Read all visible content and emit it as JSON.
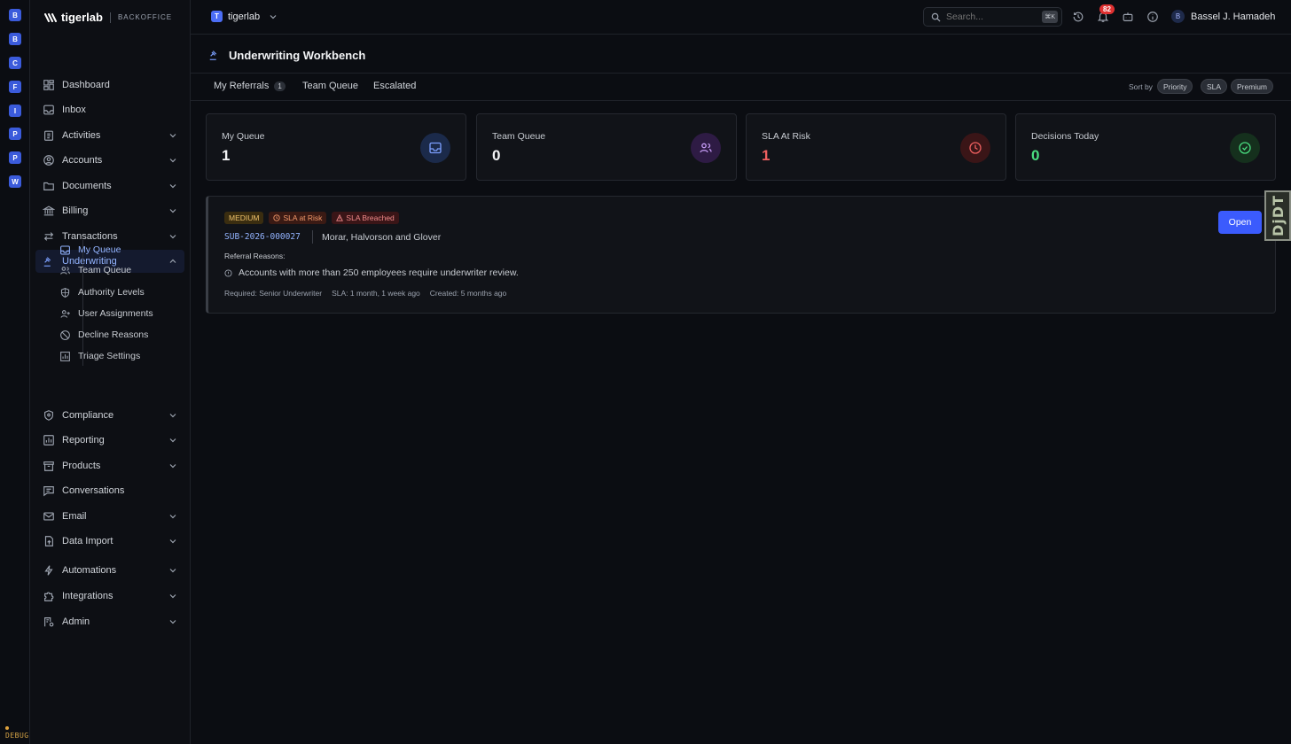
{
  "rail": {
    "items": [
      "B",
      "B",
      "C",
      "F",
      "I",
      "P",
      "P",
      "W"
    ],
    "debug": "DEBUG"
  },
  "brand": {
    "name": "tigerlab",
    "sub": "BACKOFFICE"
  },
  "sidebar": {
    "items": [
      {
        "label": "Dashboard"
      },
      {
        "label": "Inbox"
      },
      {
        "label": "Activities"
      },
      {
        "label": "Accounts"
      },
      {
        "label": "Documents"
      },
      {
        "label": "Billing"
      },
      {
        "label": "Transactions"
      },
      {
        "label": "Underwriting"
      },
      {
        "label": "Compliance"
      },
      {
        "label": "Reporting"
      },
      {
        "label": "Products"
      },
      {
        "label": "Conversations"
      },
      {
        "label": "Email"
      },
      {
        "label": "Data Import"
      },
      {
        "label": "Automations"
      },
      {
        "label": "Integrations"
      },
      {
        "label": "Admin"
      }
    ],
    "sub_items": [
      {
        "label": "My Queue"
      },
      {
        "label": "Team Queue"
      },
      {
        "label": "Authority Levels"
      },
      {
        "label": "User Assignments"
      },
      {
        "label": "Decline Reasons"
      },
      {
        "label": "Triage Settings"
      }
    ]
  },
  "topbar": {
    "tenant_initial": "T",
    "tenant_name": "tigerlab",
    "search_placeholder": "Search...",
    "search_shortcut": "⌘K",
    "notifications": "82",
    "user_initial": "B",
    "user_name": "Bassel J. Hamadeh"
  },
  "page": {
    "title": "Underwriting Workbench"
  },
  "tabs": [
    {
      "label": "My Referrals",
      "count": "1"
    },
    {
      "label": "Team Queue"
    },
    {
      "label": "Escalated"
    }
  ],
  "sort": {
    "label": "Sort by",
    "options": [
      "Priority",
      "SLA",
      "Premium"
    ]
  },
  "stats": [
    {
      "label": "My Queue",
      "value": "1",
      "color": "#f3f4f6",
      "icon": "inbox-icon",
      "icon_bg": "#1b2a4a",
      "icon_color": "#7ca0ff"
    },
    {
      "label": "Team Queue",
      "value": "0",
      "color": "#f3f4f6",
      "icon": "users-icon",
      "icon_bg": "#2e1b44",
      "icon_color": "#c59bf5"
    },
    {
      "label": "SLA At Risk",
      "value": "1",
      "color": "#f06060",
      "icon": "clock-icon",
      "icon_bg": "#3a1517",
      "icon_color": "#f06060"
    },
    {
      "label": "Decisions Today",
      "value": "0",
      "color": "#4ade80",
      "icon": "check-circle-icon",
      "icon_bg": "#15301d",
      "icon_color": "#4ade80"
    }
  ],
  "referral": {
    "badges": {
      "priority": "MEDIUM",
      "risk": "SLA at Risk",
      "breach": "SLA Breached"
    },
    "id": "SUB-2026-000027",
    "account": "Morar, Halvorson and Glover",
    "reasons_label": "Referral Reasons:",
    "reason": "Accounts with more than 250 employees require underwriter review.",
    "required": "Required: Senior Underwriter",
    "sla": "SLA: 1 month, 1 week ago",
    "created": "Created: 5 months ago",
    "open_label": "Open"
  },
  "djdt": "DjDT"
}
